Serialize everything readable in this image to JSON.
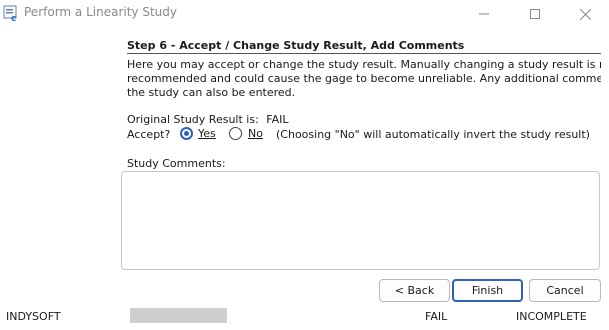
{
  "window": {
    "title": "Perform a Linearity Study"
  },
  "step": {
    "title": "Step 6 - Accept / Change Study Result, Add Comments",
    "description_lines": [
      "Here you may accept or change the study result.  Manually changing a study result is not",
      "recommended and could cause the gage to become unreliable. Any additional comments ab",
      "the study can also be entered."
    ]
  },
  "result": {
    "label": "Original Study Result is:",
    "value": "FAIL"
  },
  "accept": {
    "label": "Accept?",
    "yes_label": "Yes",
    "no_label": "No",
    "note": "(Choosing \"No\" will automatically invert the study result)"
  },
  "comments": {
    "label": "Study Comments:",
    "value": ""
  },
  "buttons": {
    "back": "< Back",
    "finish": "Finish",
    "cancel": "Cancel"
  },
  "statusbar": {
    "company": "INDYSOFT",
    "result": "FAIL",
    "state": "INCOMPLETE"
  }
}
